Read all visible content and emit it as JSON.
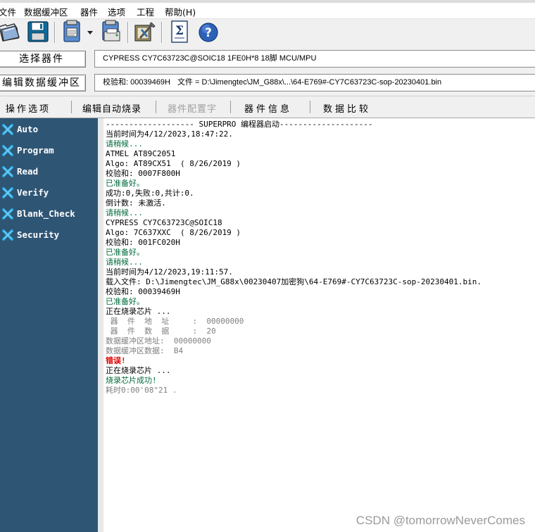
{
  "menu": {
    "items": [
      "文件",
      "数据缓冲区",
      "器件",
      "选项",
      "工程",
      "帮助(H)"
    ]
  },
  "toolbar": {
    "icons": [
      "open-folder-icon",
      "save-icon",
      "device-clipboard-icon",
      "dropdown-arrow-icon",
      "device-print-icon",
      "tools-icon",
      "sigma-document-icon",
      "help-icon"
    ]
  },
  "device_row": {
    "select_label": "选择器件",
    "device_info": "CYPRESS  CY7C63723C@SOIC18  1FE0H*8  18脚  MCU/MPU"
  },
  "buffer_row": {
    "edit_label": "编辑数据缓冲区",
    "checksum": "校验和: 00039469H",
    "file": "文件 = D:\\Jimengtec\\JM_G88x\\...\\64-E769#-CY7C63723C-sop-20230401.bin"
  },
  "tabs": [
    {
      "label": "操作选项",
      "enabled": true
    },
    {
      "label": "编辑自动烧录",
      "enabled": true
    },
    {
      "label": "器件配置字",
      "enabled": false
    },
    {
      "label": "器件信息",
      "enabled": true
    },
    {
      "label": "数据比较",
      "enabled": true
    }
  ],
  "operations": [
    "Auto",
    "Program",
    "Read",
    "Verify",
    "Blank_Check",
    "Security"
  ],
  "log": [
    {
      "text": "------------------- SUPERPRO 编程器启动--------------------",
      "color": "black"
    },
    {
      "text": "当前时间为4/12/2023,18:47:22.",
      "color": "black"
    },
    {
      "text": "请稍候...",
      "color": "green"
    },
    {
      "text": "ATMEL AT89C2051",
      "color": "black"
    },
    {
      "text": "Algo: AT89CX51  ( 8/26/2019 )",
      "color": "black"
    },
    {
      "text": "校验和: 0007F800H",
      "color": "black"
    },
    {
      "text": "已准备好。",
      "color": "green"
    },
    {
      "text": "成功:0,失败:0,共计:0.",
      "color": "black"
    },
    {
      "text": "倒计数: 未激活.",
      "color": "black"
    },
    {
      "text": "请稍候...",
      "color": "green"
    },
    {
      "text": "CYPRESS CY7C63723C@SOIC18",
      "color": "black"
    },
    {
      "text": "Algo: 7C637XXC  ( 8/26/2019 )",
      "color": "black"
    },
    {
      "text": "校验和: 001FC020H",
      "color": "black"
    },
    {
      "text": "已准备好。",
      "color": "green"
    },
    {
      "text": "请稍候...",
      "color": "green"
    },
    {
      "text": "当前时间为4/12/2023,19:11:57.",
      "color": "black"
    },
    {
      "text": "载入文件: D:\\Jimengtec\\JM_G88x\\00230407加密狗\\64-E769#-CY7C63723C-sop-20230401.bin.",
      "color": "black"
    },
    {
      "text": "校验和: 00039469H",
      "color": "black"
    },
    {
      "text": "已准备好。",
      "color": "green"
    },
    {
      "text": "正在烧录芯片 ...",
      "color": "black"
    },
    {
      "text": " 器  件  地  址     :  00000000",
      "color": "gray"
    },
    {
      "text": " 器  件  数  据     :  20",
      "color": "gray"
    },
    {
      "text": "数据缓冲区地址:  00000000",
      "color": "gray"
    },
    {
      "text": "数据缓冲区数据:  B4",
      "color": "gray"
    },
    {
      "text": "错误!",
      "color": "red"
    },
    {
      "text": "正在烧录芯片 ...",
      "color": "black"
    },
    {
      "text": "烧录芯片成功!",
      "color": "green"
    },
    {
      "text": "耗时0:00'08\"21 .",
      "color": "gray"
    }
  ],
  "watermark": "CSDN @tomorrowNeverComes",
  "colors": {
    "panel_bg": "#2f5574",
    "log_green": "#006b3c",
    "log_gray": "#808080",
    "log_red": "#dd0000",
    "op_icon_blue": "#29a8e0"
  }
}
